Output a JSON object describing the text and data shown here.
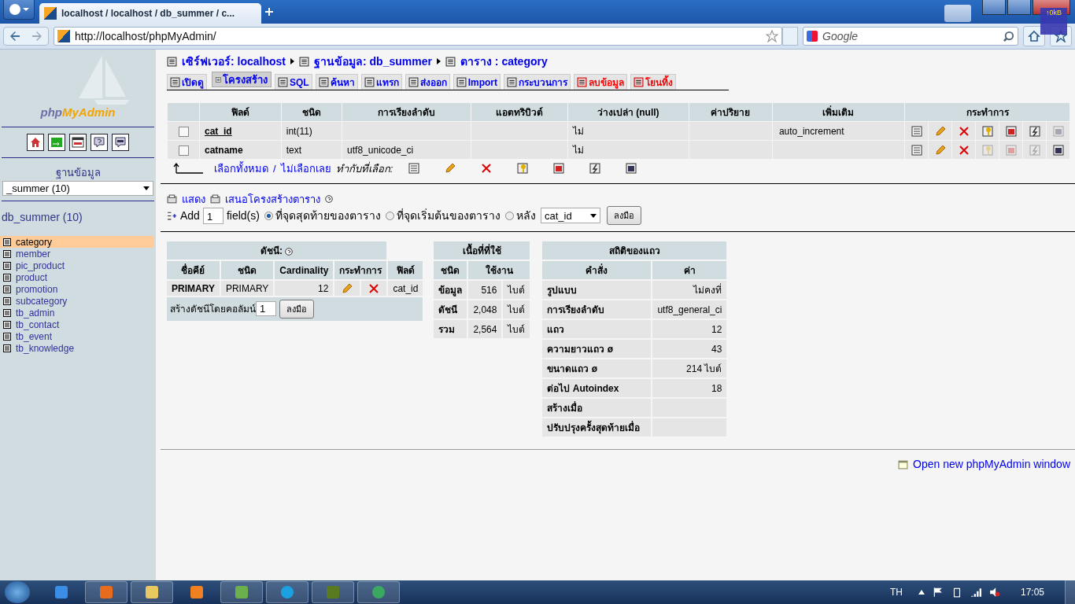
{
  "browser": {
    "tab_title": "localhost / localhost / db_summer / c...",
    "url": "http://localhost/phpMyAdmin/",
    "search_placeholder": "Google",
    "net_meter": "↑0kB"
  },
  "sidebar": {
    "logo_php": "php",
    "logo_myadmin": "MyAdmin",
    "db_label": "ฐานข้อมูล",
    "db_select": "_summer (10)",
    "db_heading": "db_summer (10)",
    "tables": [
      {
        "name": "category",
        "selected": true
      },
      {
        "name": "member",
        "selected": false
      },
      {
        "name": "pic_product",
        "selected": false
      },
      {
        "name": "product",
        "selected": false
      },
      {
        "name": "promotion",
        "selected": false
      },
      {
        "name": "subcategory",
        "selected": false
      },
      {
        "name": "tb_admin",
        "selected": false
      },
      {
        "name": "tb_contact",
        "selected": false
      },
      {
        "name": "tb_event",
        "selected": false
      },
      {
        "name": "tb_knowledge",
        "selected": false
      }
    ]
  },
  "breadcrumb": [
    {
      "label": "เซิร์ฟเวอร์: localhost"
    },
    {
      "label": "ฐานข้อมูล: db_summer"
    },
    {
      "label": "ตาราง : category"
    }
  ],
  "tabs": [
    {
      "label": "เปิดดู",
      "selected": false,
      "kind": "normal"
    },
    {
      "label": "โครงสร้าง",
      "selected": true,
      "kind": "normal"
    },
    {
      "label": "SQL",
      "selected": false,
      "kind": "normal"
    },
    {
      "label": "ค้นหา",
      "selected": false,
      "kind": "normal"
    },
    {
      "label": "แทรก",
      "selected": false,
      "kind": "normal"
    },
    {
      "label": "ส่งออก",
      "selected": false,
      "kind": "normal"
    },
    {
      "label": "Import",
      "selected": false,
      "kind": "normal"
    },
    {
      "label": "กระบวนการ",
      "selected": false,
      "kind": "normal"
    },
    {
      "label": "ลบข้อมูล",
      "selected": false,
      "kind": "danger"
    },
    {
      "label": "โยนทิ้ง",
      "selected": false,
      "kind": "danger"
    }
  ],
  "fields": {
    "columns": [
      "ฟิลด์",
      "ชนิด",
      "การเรียงลำดับ",
      "แอตทริบิวต์",
      "ว่างเปล่า (null)",
      "ค่าปริยาย",
      "เพิ่มเติม",
      "กระทำการ"
    ],
    "rows": [
      {
        "checked": false,
        "field": "cat_id",
        "primary": true,
        "type": "int(11)",
        "collation": "",
        "attributes": "",
        "null": "ไม่",
        "default": "",
        "extra": "auto_increment",
        "actions": [
          {
            "disabled": false
          },
          {
            "disabled": false
          },
          {
            "disabled": false
          },
          {
            "disabled": false
          },
          {
            "disabled": false
          },
          {
            "disabled": false
          },
          {
            "disabled": true
          }
        ]
      },
      {
        "checked": false,
        "field": "catname",
        "primary": false,
        "type": "text",
        "collation": "utf8_unicode_ci",
        "attributes": "",
        "null": "ไม่",
        "default": "",
        "extra": "",
        "actions": [
          {
            "disabled": false
          },
          {
            "disabled": false
          },
          {
            "disabled": false
          },
          {
            "disabled": true
          },
          {
            "disabled": true
          },
          {
            "disabled": true
          },
          {
            "disabled": false
          }
        ]
      }
    ],
    "check_all": "เลือกทั้งหมด",
    "separator": "/",
    "uncheck_all": "ไม่เลือกเลย",
    "with_selected": "ทำกับที่เลือก:"
  },
  "links": [
    {
      "label": "แสดง"
    },
    {
      "label": "เสนอโครงสร้างตาราง"
    }
  ],
  "add_field": {
    "label": "Add",
    "count": "1",
    "unit": "field(s)",
    "options": [
      {
        "label": "ที่จุดสุดท้ายของตาราง",
        "selected": true
      },
      {
        "label": "ที่จุดเริ่มต้นของตาราง",
        "selected": false
      },
      {
        "label": "หลัง",
        "selected": false
      }
    ],
    "after": "cat_id",
    "button": "ลงมือ"
  },
  "indexes": {
    "title": "ดัชนี:",
    "columns": [
      "ชื่อคีย์",
      "ชนิด",
      "Cardinality",
      "กระทำการ",
      "ฟิลด์"
    ],
    "rows": [
      {
        "key": "PRIMARY",
        "type": "PRIMARY",
        "cardinality": "12",
        "field": "cat_id"
      }
    ],
    "create_label": "สร้างดัชนีโดยคอลัมน์",
    "create_count": "1",
    "button": "ลงมือ"
  },
  "space": {
    "title": "เนื้อที่ที่ใช้",
    "columns": [
      "ชนิด",
      "ใช้งาน"
    ],
    "rows": [
      {
        "type": "ข้อมูล",
        "value": "516",
        "unit": "ไบต์"
      },
      {
        "type": "ดัชนี",
        "value": "2,048",
        "unit": "ไบต์"
      },
      {
        "type": "รวม",
        "value": "2,564",
        "unit": "ไบต์"
      }
    ]
  },
  "row_stats": {
    "title": "สถิติของแถว",
    "columns": [
      "คำสั่ง",
      "ค่า"
    ],
    "rows": [
      {
        "label": "รูปแบบ",
        "value": "ไม่คงที่"
      },
      {
        "label": "การเรียงลำดับ",
        "value": "utf8_general_ci"
      },
      {
        "label": "แถว",
        "value": "12"
      },
      {
        "label": "ความยาวแถว ø",
        "value": "43"
      },
      {
        "label": "ขนาดแถว ø",
        "value": "214 ไบต์"
      },
      {
        "label": "ต่อไป Autoindex",
        "value": "18"
      },
      {
        "label": "สร้างเมื่อ",
        "value": ""
      },
      {
        "label": "ปรับปรุงครั้งสุดท้ายเมื่อ",
        "value": ""
      }
    ]
  },
  "open_window": "Open new phpMyAdmin window",
  "taskbar": {
    "language": "TH",
    "clock": "17:05"
  }
}
